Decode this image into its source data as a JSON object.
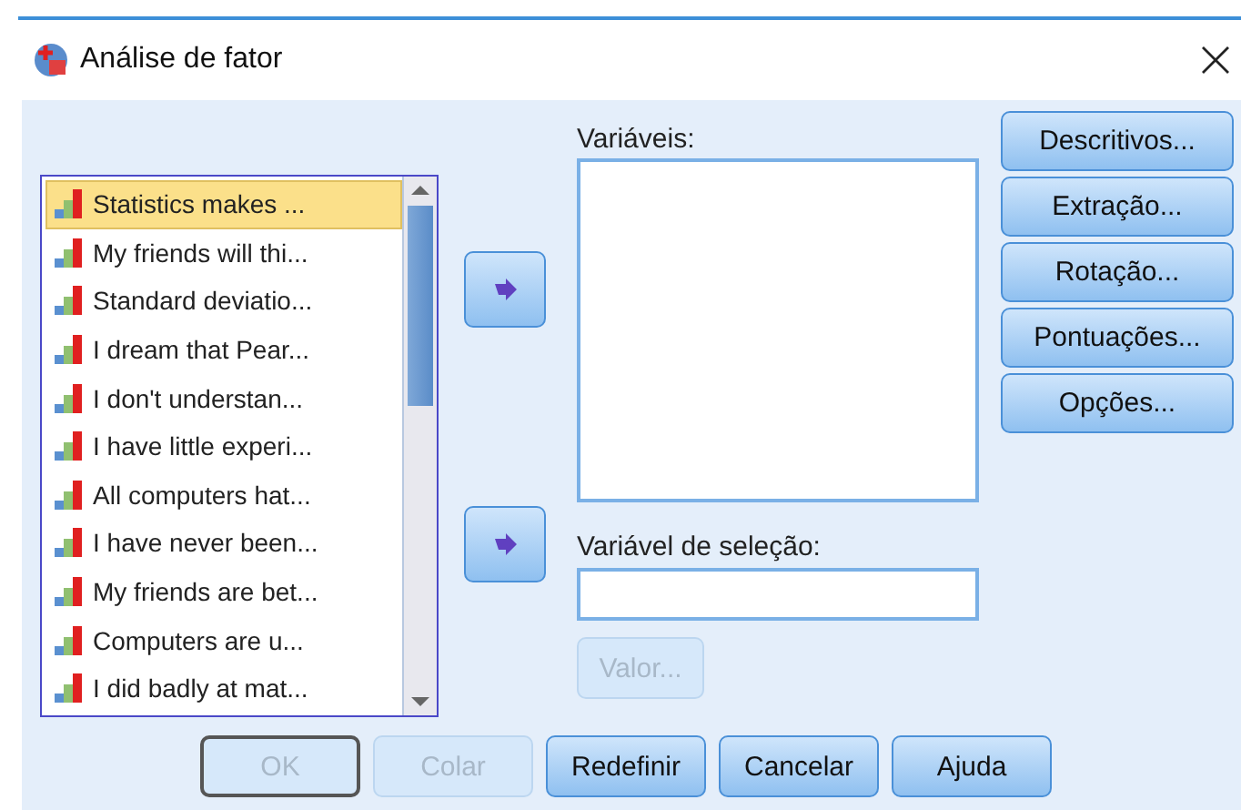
{
  "window": {
    "title": "Análise de fator"
  },
  "source_list": {
    "items": [
      {
        "label": "Statistics makes ...",
        "selected": true
      },
      {
        "label": "My friends will thi...",
        "selected": false
      },
      {
        "label": "Standard deviatio...",
        "selected": false
      },
      {
        "label": "I dream that Pear...",
        "selected": false
      },
      {
        "label": "I don't understan...",
        "selected": false
      },
      {
        "label": "I have little experi...",
        "selected": false
      },
      {
        "label": "All computers hat...",
        "selected": false
      },
      {
        "label": "I have never been...",
        "selected": false
      },
      {
        "label": "My friends are bet...",
        "selected": false
      },
      {
        "label": "Computers are u...",
        "selected": false
      },
      {
        "label": "I did badly at mat...",
        "selected": false
      }
    ]
  },
  "variables": {
    "label": "Variáveis:"
  },
  "selection_variable": {
    "label": "Variável de seleção:",
    "value_button": {
      "label": "Valor...",
      "disabled": true
    }
  },
  "side_buttons": [
    {
      "label": "Descritivos..."
    },
    {
      "label": "Extração..."
    },
    {
      "label": "Rotação..."
    },
    {
      "label": "Pontuações..."
    },
    {
      "label": "Opções..."
    }
  ],
  "buttons": [
    {
      "label": "OK",
      "disabled": true,
      "default": true
    },
    {
      "label": "Colar",
      "disabled": true,
      "default": false
    },
    {
      "label": "Redefinir",
      "disabled": false,
      "default": false
    },
    {
      "label": "Cancelar",
      "disabled": false,
      "default": false
    },
    {
      "label": "Ajuda",
      "disabled": false,
      "default": false
    }
  ]
}
